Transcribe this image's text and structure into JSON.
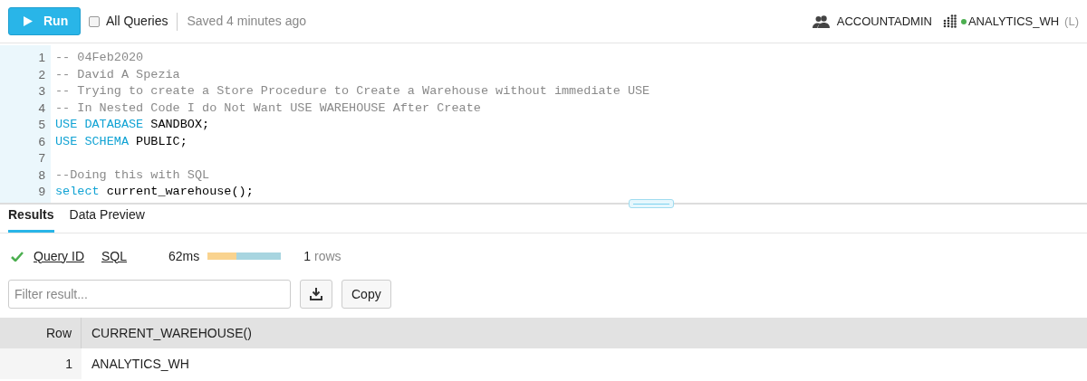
{
  "toolbar": {
    "run_button": "Run",
    "all_queries": {
      "label": "All Queries",
      "checked": false
    },
    "saved": "Saved 4 minutes ago",
    "role": "ACCOUNTADMIN",
    "warehouse": {
      "name": "ANALYTICS_WH",
      "size": "(L)",
      "color": "#4caf50"
    }
  },
  "editor": {
    "lines": [
      {
        "number": "1",
        "tokens": [
          {
            "kind": "comment",
            "text": "-- 04Feb2020"
          }
        ]
      },
      {
        "number": "2",
        "tokens": [
          {
            "kind": "comment",
            "text": "-- David A Spezia"
          }
        ]
      },
      {
        "number": "3",
        "tokens": [
          {
            "kind": "comment",
            "text": "-- Trying to create a Store Procedure to Create a Warehouse without immediate USE"
          }
        ]
      },
      {
        "number": "4",
        "tokens": [
          {
            "kind": "comment",
            "text": "-- In Nested Code I do Not Want USE WAREHOUSE After Create"
          }
        ]
      },
      {
        "number": "5",
        "tokens": [
          {
            "kind": "keyword",
            "text": "USE DATABASE"
          },
          {
            "kind": "plain",
            "text": " SANDBOX;"
          }
        ]
      },
      {
        "number": "6",
        "tokens": [
          {
            "kind": "keyword",
            "text": "USE SCHEMA"
          },
          {
            "kind": "plain",
            "text": " PUBLIC;"
          }
        ]
      },
      {
        "number": "7"
      },
      {
        "number": "8",
        "tokens": [
          {
            "kind": "comment",
            "text": "--Doing this with SQL"
          }
        ]
      },
      {
        "number": "9",
        "tokens": [
          {
            "kind": "keyword",
            "text": "select"
          },
          {
            "kind": "plain",
            "text": " current_warehouse();"
          }
        ]
      }
    ]
  },
  "results": {
    "tabs": [
      {
        "label": "Results",
        "selected": true
      },
      {
        "label": "Data Preview",
        "selected": false
      }
    ],
    "status": {
      "query_id": "Query ID",
      "sql": "SQL",
      "duration": "62ms",
      "level": 0.39,
      "row_count": "1",
      "rows_label": "rows"
    },
    "filter": {
      "placeholder": "Filter result..."
    },
    "copy_button": "Copy",
    "table": {
      "columns": [
        "Row",
        "CURRENT_WAREHOUSE()"
      ],
      "rows": [
        [
          "1",
          "ANALYTICS_WH"
        ]
      ]
    }
  }
}
